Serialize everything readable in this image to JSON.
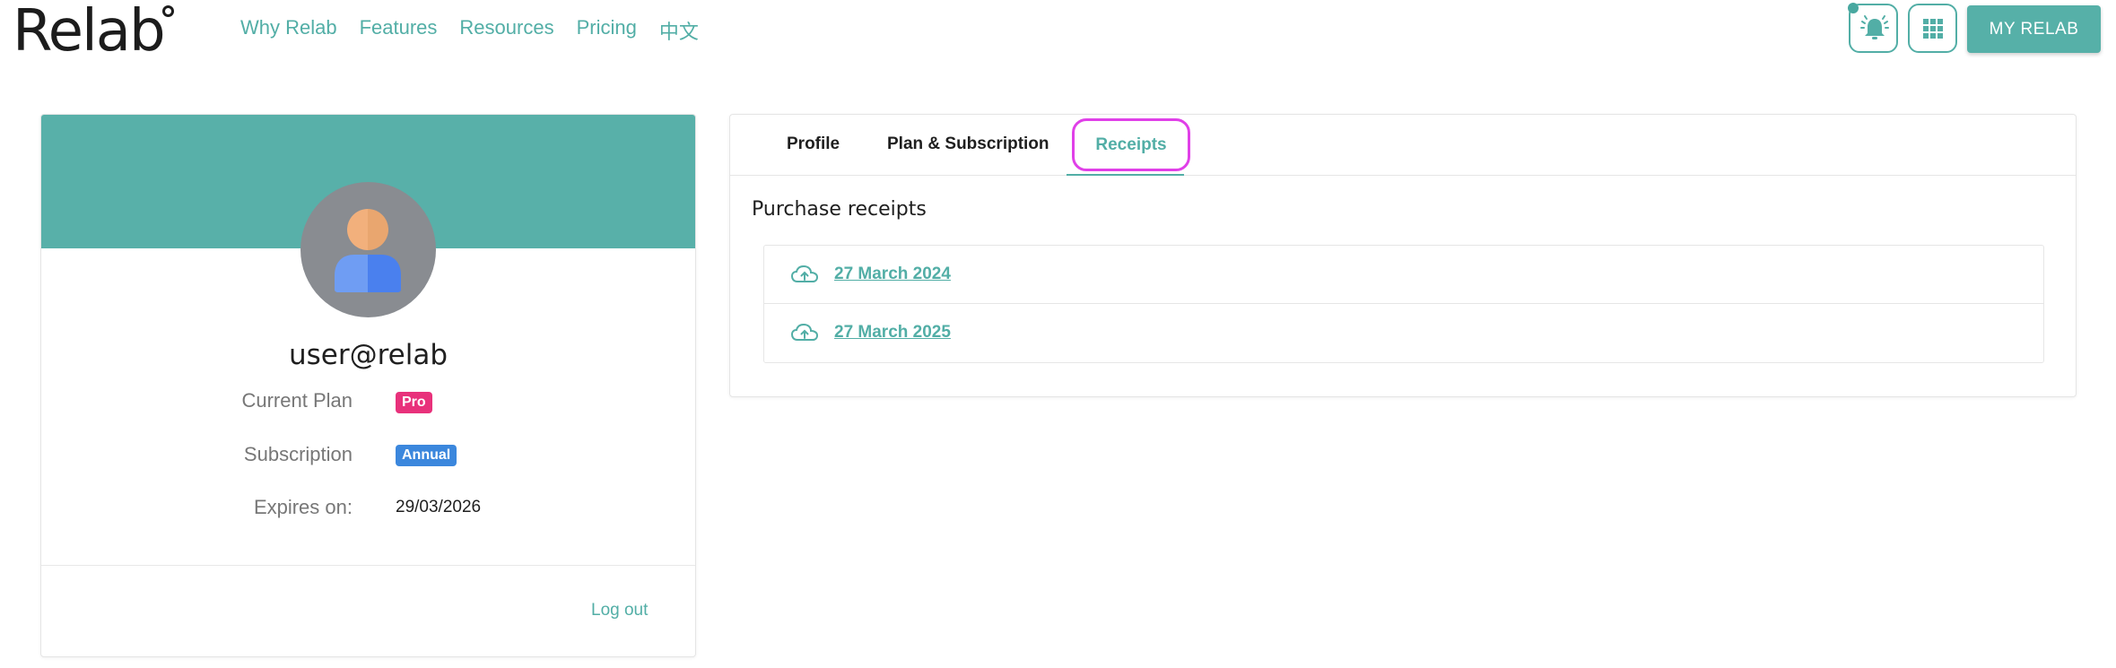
{
  "header": {
    "logo": "Relab",
    "nav": [
      {
        "label": "Why Relab"
      },
      {
        "label": "Features"
      },
      {
        "label": "Resources"
      },
      {
        "label": "Pricing"
      },
      {
        "label": "中文"
      }
    ],
    "cta_label": "MY RELAB"
  },
  "profile": {
    "username": "user@relab",
    "current_plan_label": "Current Plan",
    "current_plan_value": "Pro",
    "subscription_label": "Subscription",
    "subscription_value": "Annual",
    "expires_label": "Expires on:",
    "expires_value": "29/03/2026",
    "logout_label": "Log out"
  },
  "tabs": [
    {
      "label": "Profile"
    },
    {
      "label": "Plan & Subscription"
    },
    {
      "label": "Receipts",
      "active": true
    }
  ],
  "receipts": {
    "title": "Purchase receipts",
    "items": [
      {
        "date": "27 March 2024"
      },
      {
        "date": "27 March 2025"
      }
    ]
  },
  "colors": {
    "accent": "#52aea6",
    "banner": "#58b0a9",
    "pro_badge": "#e8317b",
    "annual_badge": "#3b87dd",
    "tab_highlight": "#e040e8"
  },
  "icons": [
    "bell-icon",
    "apps-grid-icon",
    "user-avatar-icon",
    "cloud-download-icon"
  ]
}
